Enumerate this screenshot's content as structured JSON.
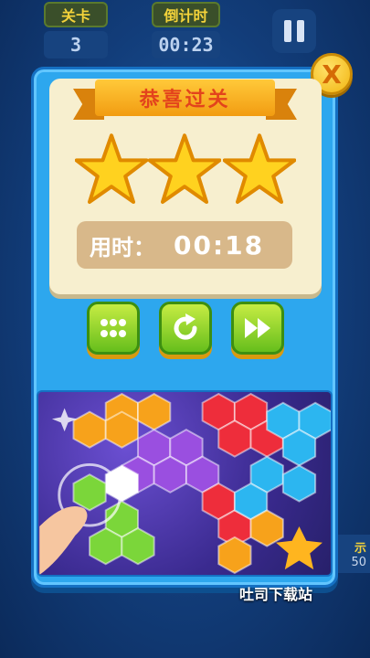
{
  "hud": {
    "level_label": "关卡",
    "level_value": "3",
    "timer_label": "倒计时",
    "timer_value": "00:23"
  },
  "side_hint": {
    "label": "示",
    "value": "50"
  },
  "result": {
    "title": "恭喜过关",
    "stars_earned": 3,
    "stars_total": 3,
    "time_label": "用时：",
    "time_value": "00:18"
  },
  "buttons": {
    "close_glyph": "X",
    "menu_icon": "grid-menu-icon",
    "replay_icon": "replay-icon",
    "next_icon": "fast-forward-icon"
  },
  "watermark": "吐司下载站",
  "colors": {
    "modal": "#2da7ee",
    "card": "#f7efcf",
    "ribbon": "#f29c12",
    "title_text": "#e3431c",
    "star": "#ffd21f",
    "button_green": "#66be1c"
  }
}
